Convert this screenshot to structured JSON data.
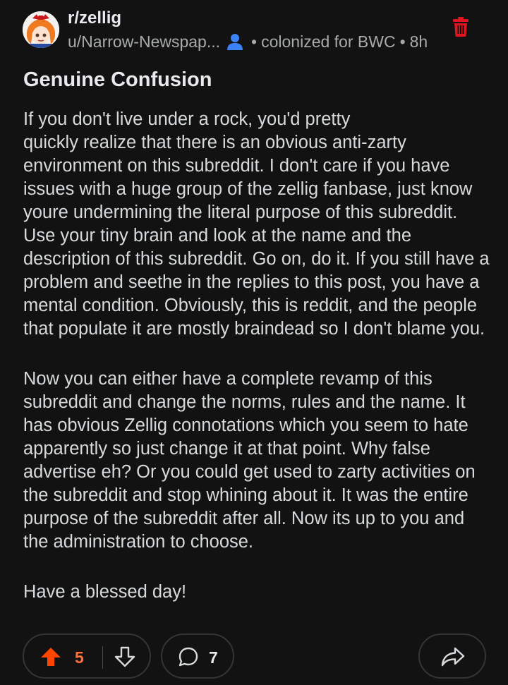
{
  "post": {
    "subreddit": "r/zellig",
    "author": "u/Narrow-Newspap...",
    "flair": "colonized for BWC",
    "separator": "•",
    "age": "8h",
    "title": "Genuine Confusion",
    "paragraphs": [
      "If you don't live under a rock, you'd pretty\nquickly realize that there is an obvious anti-zarty environment on this subreddit. I don't care if you have issues with a huge group of the zellig fanbase, just know youre undermining the literal purpose of this subreddit. Use your tiny brain and look at the name and the description of this subreddit. Go on, do it. If you still have a problem and seethe in the replies to this post, you have a mental condition. Obviously, this is reddit, and the people that populate it are mostly braindead so I don't blame you.",
      "Now you can either have a complete revamp of this subreddit and change the norms, rules and the name. It has obvious Zellig connotations which you seem to hate apparently so just change it at that point. Why false advertise eh? Or you could get used to zarty activities on the subreddit and stop whining about it. It was the entire purpose of the subreddit after all. Now its up to you and the administration to choose.",
      "Have a blessed day!"
    ]
  },
  "actions": {
    "upvotes": "5",
    "comments": "7"
  },
  "icons": {
    "avatar": "subreddit-avatar",
    "user": "user-icon",
    "delete": "trash-icon",
    "upvote": "upvote-icon",
    "downvote": "downvote-icon",
    "comment": "comment-icon",
    "share": "share-icon"
  },
  "colors": {
    "background": "#121212",
    "upvote_active": "#ff4500",
    "vote_count": "#ff6f3c",
    "user_icon": "#3b82f6",
    "delete_icon": "#e0151f"
  }
}
